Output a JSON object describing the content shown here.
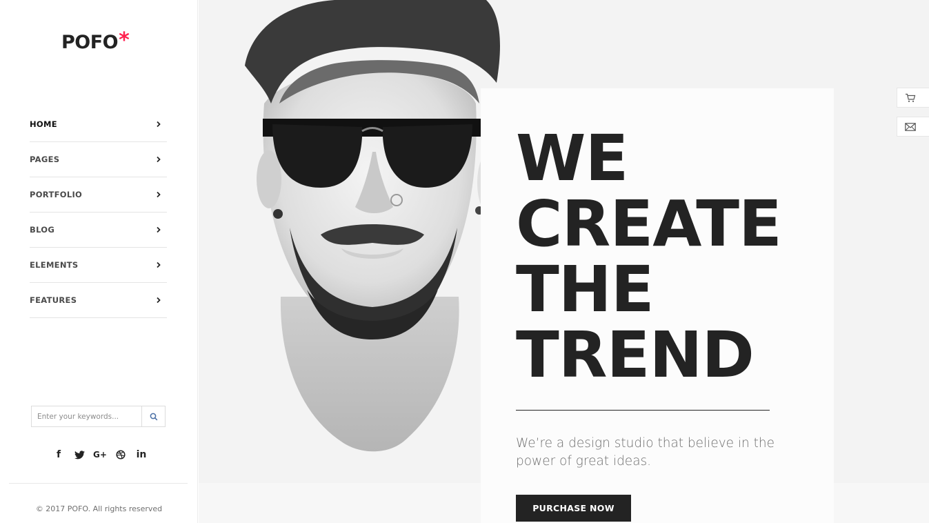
{
  "brand": {
    "name": "POFO",
    "mark": "*",
    "accent": "#ff214f"
  },
  "nav": {
    "items": [
      {
        "label": "HOME",
        "active": true
      },
      {
        "label": "PAGES"
      },
      {
        "label": "PORTFOLIO"
      },
      {
        "label": "BLOG"
      },
      {
        "label": "ELEMENTS"
      },
      {
        "label": "FEATURES"
      }
    ]
  },
  "search": {
    "placeholder": "Enter your keywords...",
    "icon": "search-icon"
  },
  "social": [
    {
      "name": "facebook-icon",
      "glyph": "f"
    },
    {
      "name": "twitter-icon"
    },
    {
      "name": "google-plus-icon",
      "glyph": "G+"
    },
    {
      "name": "dribbble-icon"
    },
    {
      "name": "linkedin-icon",
      "glyph": "in"
    }
  ],
  "footer": {
    "copyright": "© 2017 POFO. All rights reserved"
  },
  "hero": {
    "headline": [
      "WE",
      "CREATE",
      "THE",
      "TREND"
    ],
    "tagline": "We’re a design studio that believe in the power of great ideas.",
    "cta": "PURCHASE NOW"
  },
  "side_tabs": [
    {
      "name": "cart-icon"
    },
    {
      "name": "mail-icon"
    }
  ],
  "colors": {
    "dark": "#232323",
    "hero_bg": "#f3f3f3",
    "card_bg": "#fcfcfc"
  }
}
